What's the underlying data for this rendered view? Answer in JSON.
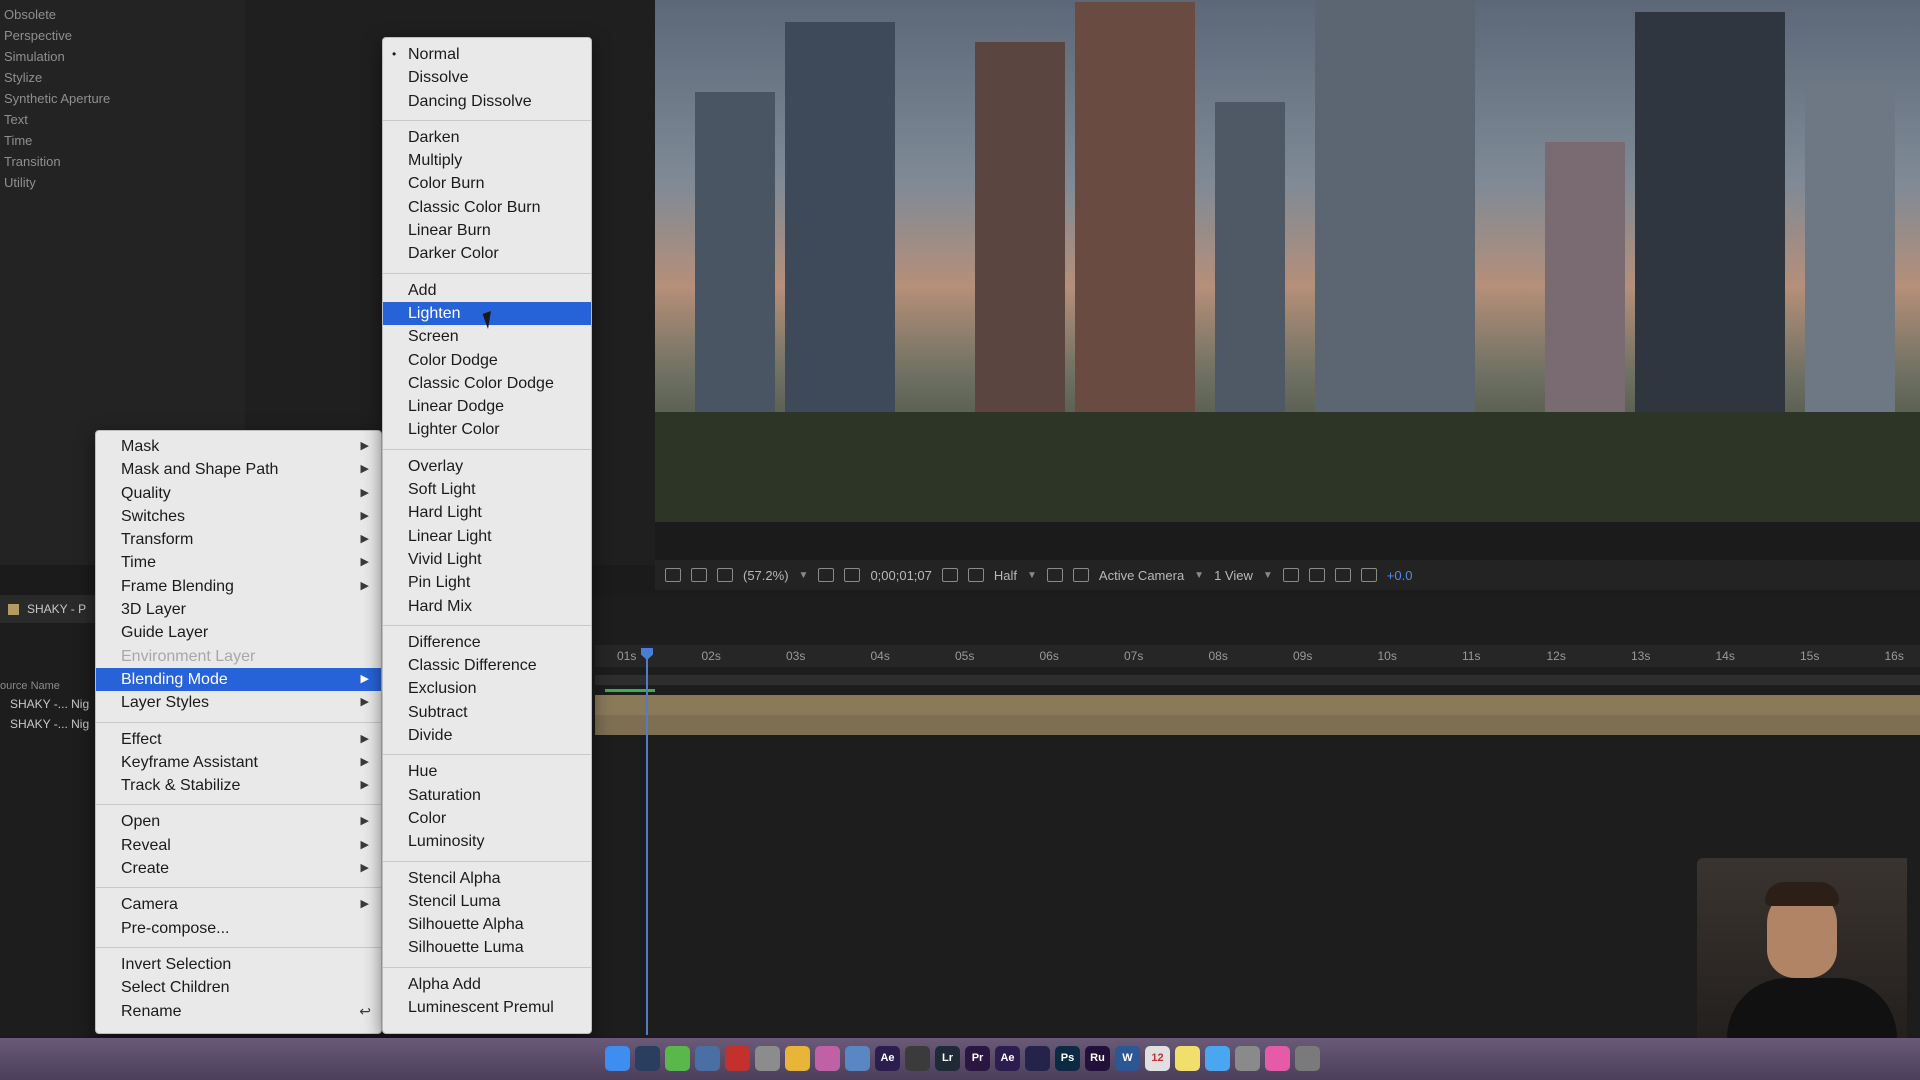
{
  "effects_panel": {
    "categories": [
      "Obsolete",
      "Perspective",
      "Simulation",
      "Stylize",
      "Synthetic Aperture",
      "Text",
      "Time",
      "Transition",
      "Utility"
    ]
  },
  "viewer_toolbar": {
    "zoom": "(57.2%)",
    "timecode": "0;00;01;07",
    "resolution": "Half",
    "camera": "Active Camera",
    "views": "1 View",
    "exposure": "+0.0"
  },
  "timeline": {
    "comp_tab": "SHAKY - P",
    "layer_column_header": "ource Name",
    "layers": [
      "SHAKY -... Nig",
      "SHAKY -... Nig"
    ],
    "ruler_ticks": [
      "01s",
      "02s",
      "03s",
      "04s",
      "05s",
      "06s",
      "07s",
      "08s",
      "09s",
      "10s",
      "11s",
      "12s",
      "13s",
      "14s",
      "15s",
      "16s"
    ]
  },
  "context_menu": {
    "items": [
      {
        "label": "Mask",
        "submenu": true
      },
      {
        "label": "Mask and Shape Path",
        "submenu": true
      },
      {
        "label": "Quality",
        "submenu": true
      },
      {
        "label": "Switches",
        "submenu": true
      },
      {
        "label": "Transform",
        "submenu": true
      },
      {
        "label": "Time",
        "submenu": true
      },
      {
        "label": "Frame Blending",
        "submenu": true
      },
      {
        "label": "3D Layer"
      },
      {
        "label": "Guide Layer"
      },
      {
        "label": "Environment Layer",
        "disabled": true
      },
      {
        "label": "Blending Mode",
        "submenu": true,
        "highlighted": true
      },
      {
        "label": "Layer Styles",
        "submenu": true
      },
      {
        "separator": true
      },
      {
        "label": "Effect",
        "submenu": true
      },
      {
        "label": "Keyframe Assistant",
        "submenu": true
      },
      {
        "label": "Track & Stabilize",
        "submenu": true
      },
      {
        "separator": true
      },
      {
        "label": "Open",
        "submenu": true
      },
      {
        "label": "Reveal",
        "submenu": true
      },
      {
        "label": "Create",
        "submenu": true
      },
      {
        "separator": true
      },
      {
        "label": "Camera",
        "submenu": true
      },
      {
        "label": "Pre-compose..."
      },
      {
        "separator": true
      },
      {
        "label": "Invert Selection"
      },
      {
        "label": "Select Children"
      },
      {
        "label": "Rename",
        "shortcut": "↩"
      }
    ]
  },
  "blending_menu": {
    "items": [
      {
        "label": "Normal",
        "checked": true
      },
      {
        "label": "Dissolve"
      },
      {
        "label": "Dancing Dissolve"
      },
      {
        "separator": true
      },
      {
        "label": "Darken"
      },
      {
        "label": "Multiply"
      },
      {
        "label": "Color Burn"
      },
      {
        "label": "Classic Color Burn"
      },
      {
        "label": "Linear Burn"
      },
      {
        "label": "Darker Color"
      },
      {
        "separator": true
      },
      {
        "label": "Add"
      },
      {
        "label": "Lighten",
        "highlighted": true
      },
      {
        "label": "Screen"
      },
      {
        "label": "Color Dodge"
      },
      {
        "label": "Classic Color Dodge"
      },
      {
        "label": "Linear Dodge"
      },
      {
        "label": "Lighter Color"
      },
      {
        "separator": true
      },
      {
        "label": "Overlay"
      },
      {
        "label": "Soft Light"
      },
      {
        "label": "Hard Light"
      },
      {
        "label": "Linear Light"
      },
      {
        "label": "Vivid Light"
      },
      {
        "label": "Pin Light"
      },
      {
        "label": "Hard Mix"
      },
      {
        "separator": true
      },
      {
        "label": "Difference"
      },
      {
        "label": "Classic Difference"
      },
      {
        "label": "Exclusion"
      },
      {
        "label": "Subtract"
      },
      {
        "label": "Divide"
      },
      {
        "separator": true
      },
      {
        "label": "Hue"
      },
      {
        "label": "Saturation"
      },
      {
        "label": "Color"
      },
      {
        "label": "Luminosity"
      },
      {
        "separator": true
      },
      {
        "label": "Stencil Alpha"
      },
      {
        "label": "Stencil Luma"
      },
      {
        "label": "Silhouette Alpha"
      },
      {
        "label": "Silhouette Luma"
      },
      {
        "separator": true
      },
      {
        "label": "Alpha Add"
      },
      {
        "label": "Luminescent Premul"
      }
    ]
  },
  "dock": {
    "icons": [
      {
        "name": "finder-icon",
        "label": "",
        "color": "#3d8ef0"
      },
      {
        "name": "steam-icon",
        "label": "",
        "color": "#2a3f5f"
      },
      {
        "name": "utorrent-icon",
        "label": "",
        "color": "#58b94a"
      },
      {
        "name": "system-icon",
        "label": "",
        "color": "#4a6fa5"
      },
      {
        "name": "filezilla-icon",
        "label": "",
        "color": "#c4302b"
      },
      {
        "name": "launchpad-icon",
        "label": "",
        "color": "#8c8c8c"
      },
      {
        "name": "chrome-icon",
        "label": "",
        "color": "#e8b43a"
      },
      {
        "name": "game-icon",
        "label": "",
        "color": "#c061a6"
      },
      {
        "name": "preview-icon",
        "label": "",
        "color": "#5b86c4"
      },
      {
        "name": "after-effects-icon",
        "label": "Ae",
        "color": "#2b1d4f"
      },
      {
        "name": "utility-icon",
        "label": "",
        "color": "#3b3b3b"
      },
      {
        "name": "lightroom-icon",
        "label": "Lr",
        "color": "#1e2a38"
      },
      {
        "name": "premiere-icon",
        "label": "Pr",
        "color": "#2a1640"
      },
      {
        "name": "after-effects-2-icon",
        "label": "Ae",
        "color": "#2b1d4f"
      },
      {
        "name": "media-encoder-icon",
        "label": "",
        "color": "#24244a"
      },
      {
        "name": "photoshop-icon",
        "label": "Ps",
        "color": "#0c2a44"
      },
      {
        "name": "rush-icon",
        "label": "Ru",
        "color": "#22103a"
      },
      {
        "name": "word-icon",
        "label": "W",
        "color": "#2b5797"
      },
      {
        "name": "calendar-icon",
        "label": "12",
        "color": "#e0e0e0"
      },
      {
        "name": "notes-icon",
        "label": "",
        "color": "#f2df6b"
      },
      {
        "name": "messages-icon",
        "label": "",
        "color": "#4aa6f0"
      },
      {
        "name": "settings-icon",
        "label": "",
        "color": "#8a8a8a"
      },
      {
        "name": "itunes-icon",
        "label": "",
        "color": "#e55ba8"
      },
      {
        "name": "trash-icon",
        "label": "",
        "color": "#7a7a7a"
      }
    ]
  }
}
